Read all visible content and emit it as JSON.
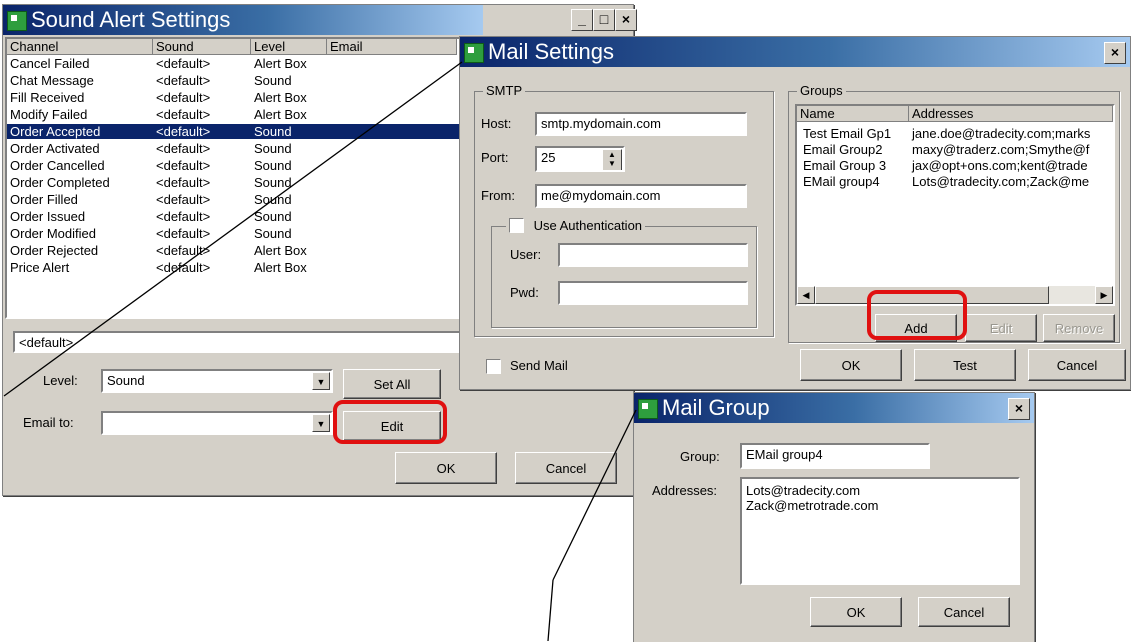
{
  "sound_window": {
    "title": "Sound Alert Settings",
    "columns": [
      "Channel",
      "Sound",
      "Level",
      "Email"
    ],
    "rows": [
      {
        "channel": "Cancel Failed",
        "sound": "<default>",
        "level": "Alert Box"
      },
      {
        "channel": "Chat Message",
        "sound": "<default>",
        "level": "Sound"
      },
      {
        "channel": "Fill Received",
        "sound": "<default>",
        "level": "Alert Box"
      },
      {
        "channel": "Modify Failed",
        "sound": "<default>",
        "level": "Alert Box"
      },
      {
        "channel": "Order Accepted",
        "sound": "<default>",
        "level": "Sound"
      },
      {
        "channel": "Order Activated",
        "sound": "<default>",
        "level": "Sound"
      },
      {
        "channel": "Order Cancelled",
        "sound": "<default>",
        "level": "Sound"
      },
      {
        "channel": "Order Completed",
        "sound": "<default>",
        "level": "Sound"
      },
      {
        "channel": "Order Filled",
        "sound": "<default>",
        "level": "Sound"
      },
      {
        "channel": "Order Issued",
        "sound": "<default>",
        "level": "Sound"
      },
      {
        "channel": "Order Modified",
        "sound": "<default>",
        "level": "Sound"
      },
      {
        "channel": "Order Rejected",
        "sound": "<default>",
        "level": "Alert Box"
      },
      {
        "channel": "Price Alert",
        "sound": "<default>",
        "level": "Alert Box"
      }
    ],
    "selected_row": 4,
    "sound_field_value": "<default>",
    "level_label": "Level:",
    "level_value": "Sound",
    "set_all_label": "Set All",
    "email_to_label": "Email to:",
    "email_to_value": "",
    "edit_label": "Edit",
    "ok_label": "OK",
    "cancel_label": "Cancel",
    "min_label": "_",
    "max_label": "□",
    "close_label": "×"
  },
  "mail_window": {
    "title": "Mail Settings",
    "close_label": "×",
    "smtp_title": "SMTP",
    "host_label": "Host:",
    "host_value": "smtp.mydomain.com",
    "port_label": "Port:",
    "port_value": "25",
    "from_label": "From:",
    "from_value": "me@mydomain.com",
    "use_auth_label": "Use Authentication",
    "user_label": "User:",
    "user_value": "",
    "pwd_label": "Pwd:",
    "pwd_value": "",
    "groups_title": "Groups",
    "groups_columns": [
      "Name",
      "Addresses"
    ],
    "groups": [
      {
        "name": "Test Email Gp1",
        "addresses": "jane.doe@tradecity.com;marks"
      },
      {
        "name": "Email Group2",
        "addresses": "maxy@traderz.com;Smythe@f"
      },
      {
        "name": "Email Group 3",
        "addresses": "jax@opt+ons.com;kent@trade"
      },
      {
        "name": "EMail group4",
        "addresses": "Lots@tradecity.com;Zack@me"
      }
    ],
    "add_label": "Add",
    "edit_label": "Edit",
    "remove_label": "Remove",
    "send_mail_label": "Send Mail",
    "ok_label": "OK",
    "test_label": "Test",
    "cancel_label": "Cancel"
  },
  "group_window": {
    "title": "Mail Group",
    "close_label": "×",
    "group_label": "Group:",
    "group_value": "EMail group4",
    "addresses_label": "Addresses:",
    "address_lines": [
      "Lots@tradecity.com",
      "Zack@metrotrade.com"
    ],
    "ok_label": "OK",
    "cancel_label": "Cancel"
  },
  "colors": {
    "highlight": "#e01010",
    "selection": "#0a246a",
    "window_bg": "#d4d0c8"
  }
}
